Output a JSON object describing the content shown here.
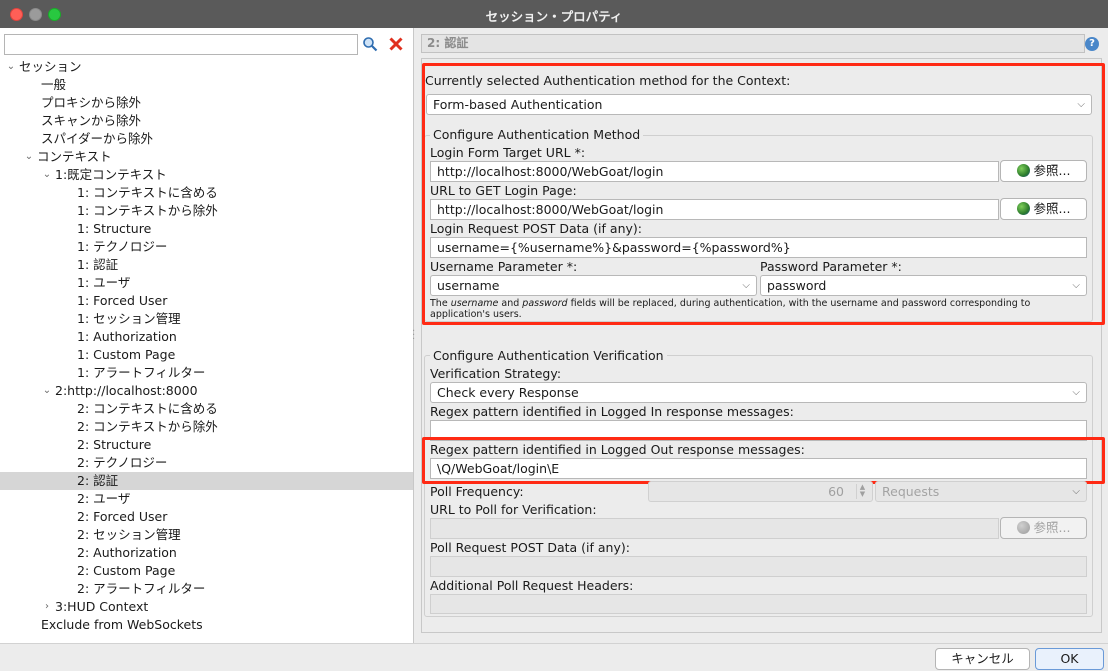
{
  "window": {
    "title": "セッション・プロパティ"
  },
  "left": {
    "filter": {
      "value": "",
      "placeholder": ""
    },
    "tree": [
      {
        "label": "セッション",
        "level": 0,
        "arrow": "down"
      },
      {
        "label": "一般",
        "level": 1
      },
      {
        "label": "プロキシから除外",
        "level": 1
      },
      {
        "label": "スキャンから除外",
        "level": 1
      },
      {
        "label": "スパイダーから除外",
        "level": 1
      },
      {
        "label": "コンテキスト",
        "level": 1,
        "arrow": "down"
      },
      {
        "label": "1:既定コンテキスト",
        "level": 2,
        "arrow": "down"
      },
      {
        "label": "1: コンテキストに含める",
        "level": 3
      },
      {
        "label": "1: コンテキストから除外",
        "level": 3
      },
      {
        "label": "1: Structure",
        "level": 3
      },
      {
        "label": "1: テクノロジー",
        "level": 3
      },
      {
        "label": "1: 認証",
        "level": 3
      },
      {
        "label": "1: ユーザ",
        "level": 3
      },
      {
        "label": "1: Forced User",
        "level": 3
      },
      {
        "label": "1: セッション管理",
        "level": 3
      },
      {
        "label": "1: Authorization",
        "level": 3
      },
      {
        "label": "1: Custom Page",
        "level": 3
      },
      {
        "label": "1: アラートフィルター",
        "level": 3
      },
      {
        "label": "2:http://localhost:8000",
        "level": 2,
        "arrow": "down"
      },
      {
        "label": "2: コンテキストに含める",
        "level": 3
      },
      {
        "label": "2: コンテキストから除外",
        "level": 3
      },
      {
        "label": "2: Structure",
        "level": 3
      },
      {
        "label": "2: テクノロジー",
        "level": 3
      },
      {
        "label": "2: 認証",
        "level": 3,
        "selected": true
      },
      {
        "label": "2: ユーザ",
        "level": 3
      },
      {
        "label": "2: Forced User",
        "level": 3
      },
      {
        "label": "2: セッション管理",
        "level": 3
      },
      {
        "label": "2: Authorization",
        "level": 3
      },
      {
        "label": "2: Custom Page",
        "level": 3
      },
      {
        "label": "2: アラートフィルター",
        "level": 3
      },
      {
        "label": "3:HUD Context",
        "level": 2,
        "arrow": "right"
      },
      {
        "label": "Exclude from WebSockets",
        "level": 1
      }
    ]
  },
  "right": {
    "header": "2: 認証",
    "help_icon": "?",
    "method_label": "Currently selected Authentication method for the Context:",
    "method_value": "Form-based Authentication",
    "configure_method_title": "Configure Authentication Method",
    "login_form_url_label": "Login Form Target URL *:",
    "login_form_url_value": "http://localhost:8000/WebGoat/login",
    "browse_label": "参照...",
    "login_page_label": "URL to GET Login Page:",
    "login_page_value": "http://localhost:8000/WebGoat/login",
    "post_data_label": "Login Request POST Data (if any):",
    "post_data_value": "username={%username%}&password={%password%}",
    "username_param_label": "Username Parameter *:",
    "username_param_value": "username",
    "password_param_label": "Password Parameter *:",
    "password_param_value": "password",
    "note_part1": "The ",
    "note_username": "username",
    "note_part2": " and ",
    "note_password": "password",
    "note_part3": " fields will be replaced, during authentication, with the username and password corresponding to application's users.",
    "configure_verification_title": "Configure Authentication Verification",
    "verification_strategy_label": "Verification Strategy:",
    "verification_strategy_value": "Check every Response",
    "logged_in_label": "Regex pattern identified in Logged In response messages:",
    "logged_in_value": "",
    "logged_out_label": "Regex pattern identified in Logged Out response messages:",
    "logged_out_value": "\\Q/WebGoat/login\\E",
    "poll_frequency_label": "Poll Frequency:",
    "poll_frequency_value": "60",
    "poll_unit_value": "Requests",
    "poll_url_label": "URL to Poll for Verification:",
    "poll_url_value": "",
    "poll_post_label": "Poll Request POST Data (if any):",
    "poll_post_value": "",
    "poll_headers_label": "Additional Poll Request Headers:"
  },
  "buttons": {
    "cancel": "キャンセル",
    "ok": "OK"
  },
  "colors": {
    "highlight": "#ff2a14",
    "selected_row": "#d6d6d6"
  }
}
